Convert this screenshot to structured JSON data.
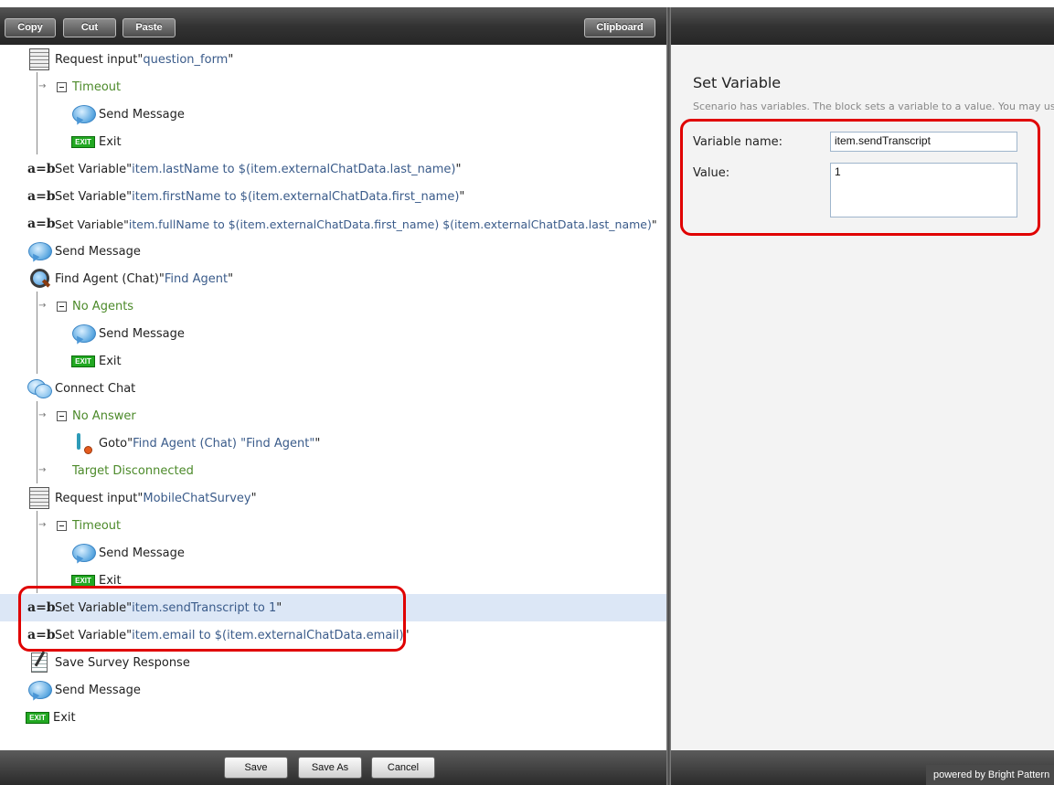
{
  "toolbar": {
    "copy": "Copy",
    "cut": "Cut",
    "paste": "Paste",
    "clipboard": "Clipboard"
  },
  "tree": {
    "r0": {
      "kw": "Request input ",
      "q1": "\"",
      "val": "question_form",
      "q2": "\""
    },
    "r1": {
      "label": "Timeout"
    },
    "r2": {
      "label": "Send Message"
    },
    "r3": {
      "icon": "EXIT",
      "label": "Exit"
    },
    "r4": {
      "ab": "a=b",
      "kw": "Set Variable ",
      "q1": "\"",
      "val": "item.lastName to $(item.externalChatData.last_name)",
      "q2": "\""
    },
    "r5": {
      "ab": "a=b",
      "kw": "Set Variable ",
      "q1": "\"",
      "val": "item.firstName to $(item.externalChatData.first_name)",
      "q2": "\""
    },
    "r6": {
      "ab": "a=b",
      "kw": "Set Variable ",
      "q1": "\"",
      "val": "item.fullName to $(item.externalChatData.first_name) $(item.externalChatData.last_name)",
      "q2": "\""
    },
    "r7": {
      "label": "Send Message"
    },
    "r8": {
      "kw": "Find Agent (Chat) ",
      "q1": "\"",
      "val": "Find Agent",
      "q2": "\""
    },
    "r9": {
      "label": "No Agents"
    },
    "r10": {
      "label": "Send Message"
    },
    "r11": {
      "icon": "EXIT",
      "label": "Exit"
    },
    "r12": {
      "label": "Connect Chat"
    },
    "r13": {
      "label": "No Answer"
    },
    "r14": {
      "kw": "Goto ",
      "q1": "\"",
      "val": "Find Agent (Chat) \"Find Agent\"",
      "q2": "\""
    },
    "r15": {
      "label": "Target Disconnected"
    },
    "r16": {
      "kw": "Request input ",
      "q1": "\"",
      "val": "MobileChatSurvey",
      "q2": "\""
    },
    "r17": {
      "label": "Timeout"
    },
    "r18": {
      "label": "Send Message"
    },
    "r19": {
      "icon": "EXIT",
      "label": "Exit"
    },
    "r20": {
      "ab": "a=b",
      "kw": "Set Variable ",
      "q1": "\"",
      "val": "item.sendTranscript to 1",
      "q2": "\""
    },
    "r21": {
      "ab": "a=b",
      "kw": "Set Variable ",
      "q1": "\"",
      "val": "item.email to $(item.externalChatData.email)",
      "q2": "\""
    },
    "r22": {
      "label": "Save Survey Response"
    },
    "r23": {
      "label": "Send Message"
    },
    "r24": {
      "icon": "EXIT",
      "label": "Exit"
    }
  },
  "props": {
    "title": "Set Variable",
    "description": "Scenario has variables. The block sets a variable to a value. You may use $",
    "variable_name_label": "Variable name:",
    "variable_name_value": "item.sendTranscript",
    "value_label": "Value:",
    "value_value": "1"
  },
  "footer": {
    "save": "Save",
    "save_as": "Save As",
    "cancel": "Cancel",
    "powered_by": "powered by Bright Pattern"
  },
  "colors": {
    "highlight": "#e00000",
    "selected_row": "#dce7f6",
    "branch_text": "#4c8a2a",
    "value_text": "#3a5b8a"
  }
}
